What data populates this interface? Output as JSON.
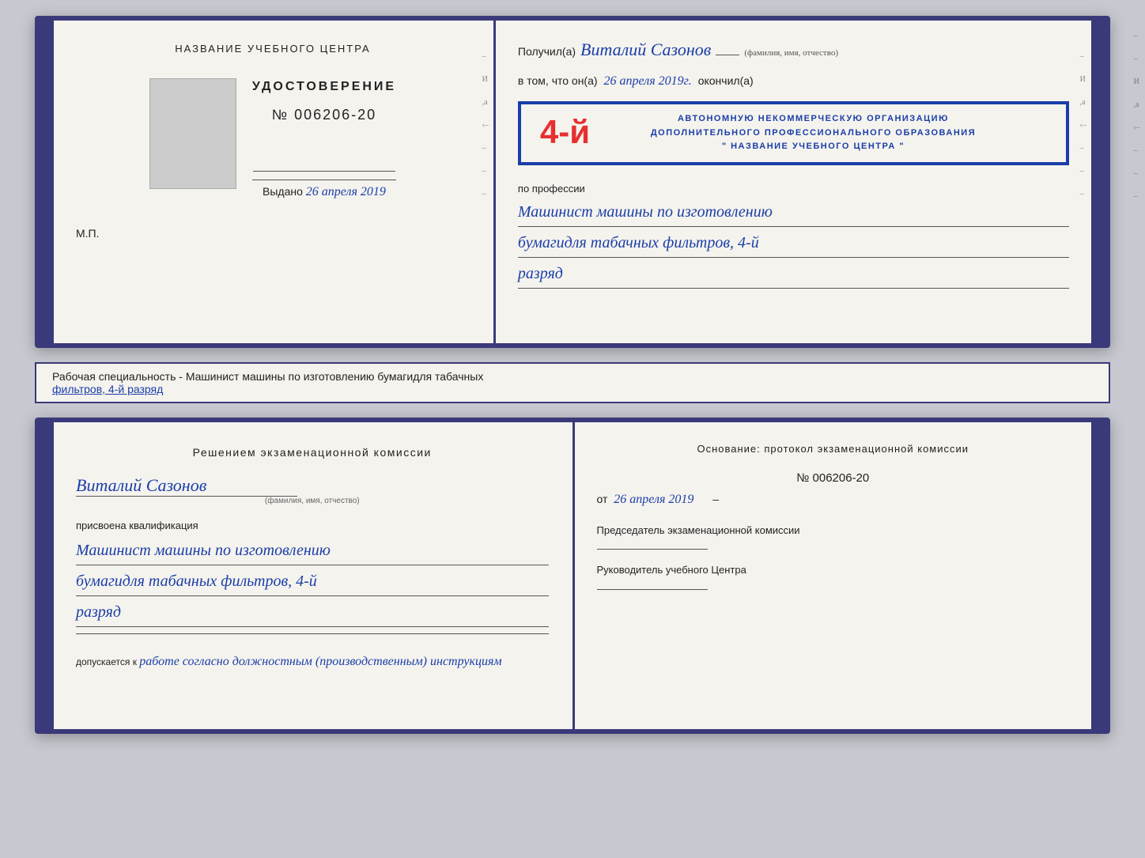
{
  "doc1": {
    "left": {
      "page_title": "НАЗВАНИЕ УЧЕБНОГО ЦЕНТРА",
      "cert_main_title": "УДОСТОВЕРЕНИЕ",
      "cert_number": "№ 006206-20",
      "issued_label": "Выдано",
      "issued_date": "26 апреля 2019",
      "mp_label": "М.П."
    },
    "right": {
      "received_label": "Получил(а)",
      "person_name": "Виталий Сазонов",
      "person_subtitle": "(фамилия, имя, отчество)",
      "in_that_label": "в том, что он(а)",
      "date_handwritten": "26 апреля 2019г.",
      "finished_label": "окончил(а)",
      "stamp_number": "4-й",
      "stamp_line1": "АВТОНОМНУЮ НЕКОММЕРЧЕСКУЮ ОРГАНИЗАЦИЮ",
      "stamp_line2": "ДОПОЛНИТЕЛЬНОГО ПРОФЕССИОНАЛЬНОГО ОБРАЗОВАНИЯ",
      "stamp_line3": "\" НАЗВАНИЕ УЧЕБНОГО ЦЕНТРА \"",
      "profession_label": "по профессии",
      "profession_line1": "Машинист машины по изготовлению",
      "profession_line2": "бумагидля табачных фильтров, 4-й",
      "profession_line3": "разряд"
    }
  },
  "annotation": {
    "text_before": "Рабочая специальность - Машинист машины по изготовлению бумагидля табачных",
    "text_underlined": "фильтров, 4-й разряд"
  },
  "doc2": {
    "left": {
      "section_title": "Решением  экзаменационной  комиссии",
      "person_name": "Виталий Сазонов",
      "person_subtitle": "(фамилия, имя, отчество)",
      "assigned_label": "присвоена квалификация",
      "qualification_line1": "Машинист машины по изготовлению",
      "qualification_line2": "бумагидля табачных фильтров, 4-й",
      "qualification_line3": "разряд",
      "allow_label": "допускается к",
      "allow_text": "работе согласно должностным (производственным) инструкциям"
    },
    "right": {
      "basis_label": "Основание: протокол экзаменационной  комиссии",
      "number_label": "№  006206-20",
      "date_prefix": "от",
      "date_value": "26 апреля 2019",
      "chairman_title": "Председатель экзаменационной комиссии",
      "center_head_title": "Руководитель учебного Центра"
    }
  }
}
